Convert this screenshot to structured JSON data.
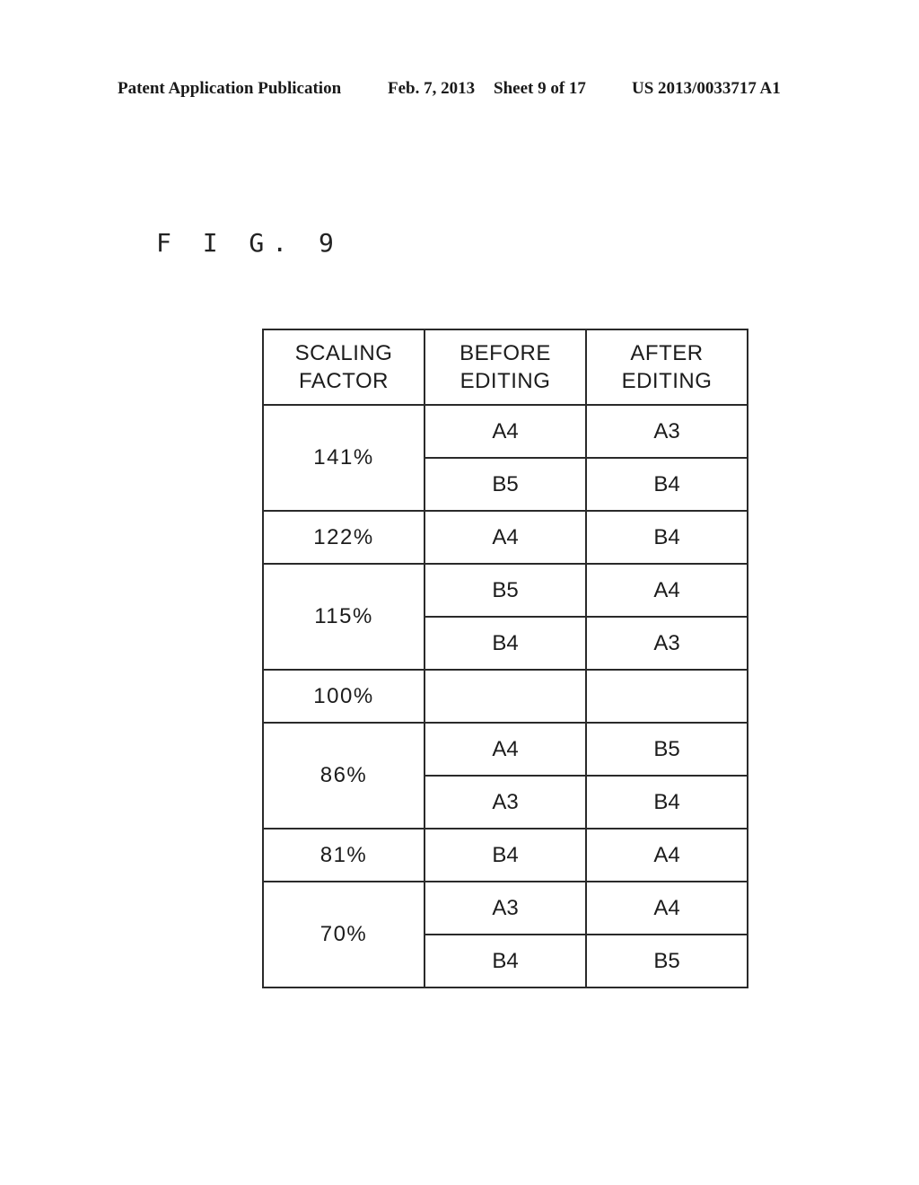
{
  "header": {
    "publication": "Patent Application Publication",
    "date": "Feb. 7, 2013",
    "sheet": "Sheet 9 of 17",
    "number": "US 2013/0033717 A1"
  },
  "figure_label": "F I G. 9",
  "table": {
    "headers": [
      [
        "SCALING",
        "FACTOR"
      ],
      [
        "BEFORE",
        "EDITING"
      ],
      [
        "AFTER",
        "EDITING"
      ]
    ],
    "groups": [
      {
        "scaling": "141%",
        "rows": [
          {
            "before": "A4",
            "after": "A3"
          },
          {
            "before": "B5",
            "after": "B4"
          }
        ]
      },
      {
        "scaling": "122%",
        "rows": [
          {
            "before": "A4",
            "after": "B4"
          }
        ]
      },
      {
        "scaling": "115%",
        "rows": [
          {
            "before": "B5",
            "after": "A4"
          },
          {
            "before": "B4",
            "after": "A3"
          }
        ]
      },
      {
        "scaling": "100%",
        "rows": [
          {
            "before": "",
            "after": ""
          }
        ]
      },
      {
        "scaling": "86%",
        "rows": [
          {
            "before": "A4",
            "after": "B5"
          },
          {
            "before": "A3",
            "after": "B4"
          }
        ]
      },
      {
        "scaling": "81%",
        "rows": [
          {
            "before": "B4",
            "after": "A4"
          }
        ]
      },
      {
        "scaling": "70%",
        "rows": [
          {
            "before": "A3",
            "after": "A4"
          },
          {
            "before": "B4",
            "after": "B5"
          }
        ]
      }
    ]
  }
}
